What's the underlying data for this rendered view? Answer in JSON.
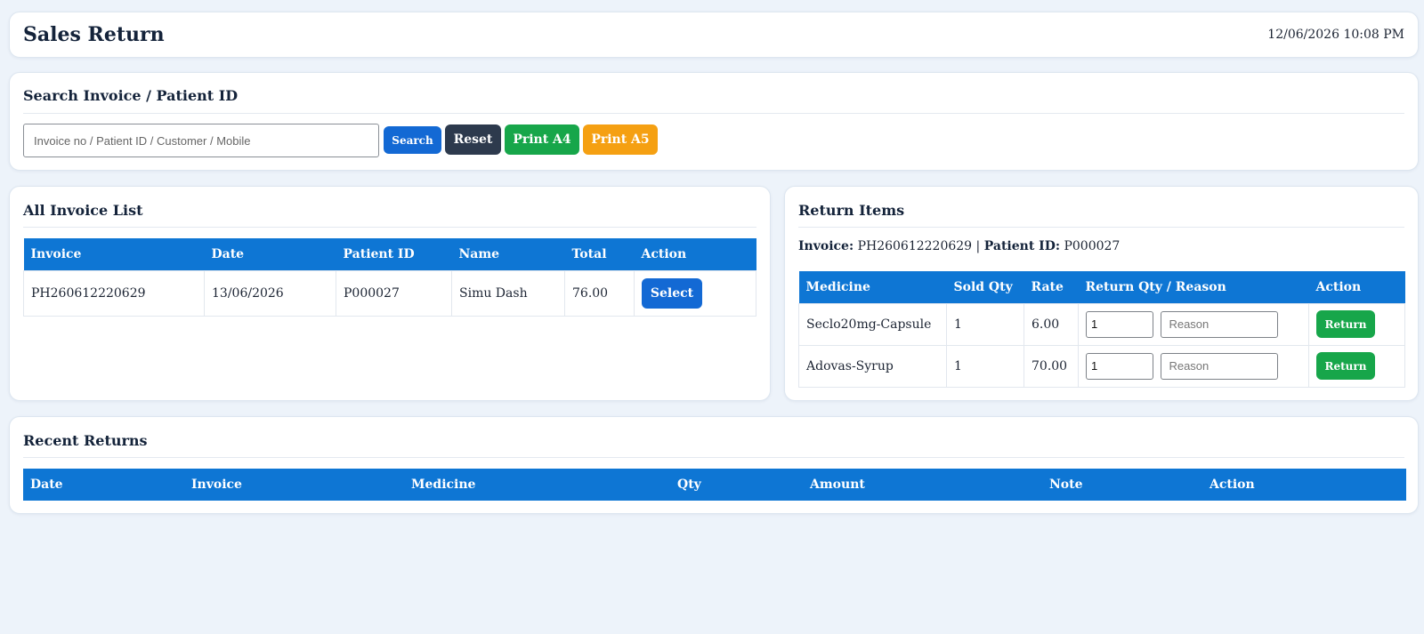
{
  "header": {
    "title": "Sales Return",
    "datetime": "12/06/2026 10:08 PM"
  },
  "search": {
    "title": "Search Invoice / Patient ID",
    "placeholder": "Invoice no / Patient ID / Customer / Mobile",
    "value": "",
    "buttons": {
      "search": "Search",
      "reset": "Reset",
      "print_a4": "Print A4",
      "print_a5": "Print A5"
    }
  },
  "invoice_list": {
    "title": "All Invoice List",
    "columns": [
      "Invoice",
      "Date",
      "Patient ID",
      "Name",
      "Total",
      "Action"
    ],
    "rows": [
      {
        "invoice": "PH260612220629",
        "date": "13/06/2026",
        "patient_id": "P000027",
        "name": "Simu Dash",
        "total": "76.00",
        "action": "Select"
      }
    ]
  },
  "return_items": {
    "title": "Return Items",
    "invoice_label": "Invoice:",
    "invoice_value": "PH260612220629",
    "separator": "|",
    "patient_label": "Patient ID:",
    "patient_value": "P000027",
    "columns": [
      "Medicine",
      "Sold Qty",
      "Rate",
      "Return Qty / Reason",
      "Action"
    ],
    "rows": [
      {
        "medicine": "Seclo20mg-Capsule",
        "sold_qty": "1",
        "rate": "6.00",
        "return_qty": "1",
        "reason_placeholder": "Reason",
        "action": "Return"
      },
      {
        "medicine": "Adovas-Syrup",
        "sold_qty": "1",
        "rate": "70.00",
        "return_qty": "1",
        "reason_placeholder": "Reason",
        "action": "Return"
      }
    ]
  },
  "recent_returns": {
    "title": "Recent Returns",
    "columns": [
      "Date",
      "Invoice",
      "Medicine",
      "Qty",
      "Amount",
      "Note",
      "Action"
    ]
  },
  "colors": {
    "page_bg": "#edf3fa",
    "table_header": "#0e76d4",
    "primary": "#1369d4",
    "dark": "#2d3a4d",
    "success": "#17a64a",
    "warning": "#f5a012"
  }
}
